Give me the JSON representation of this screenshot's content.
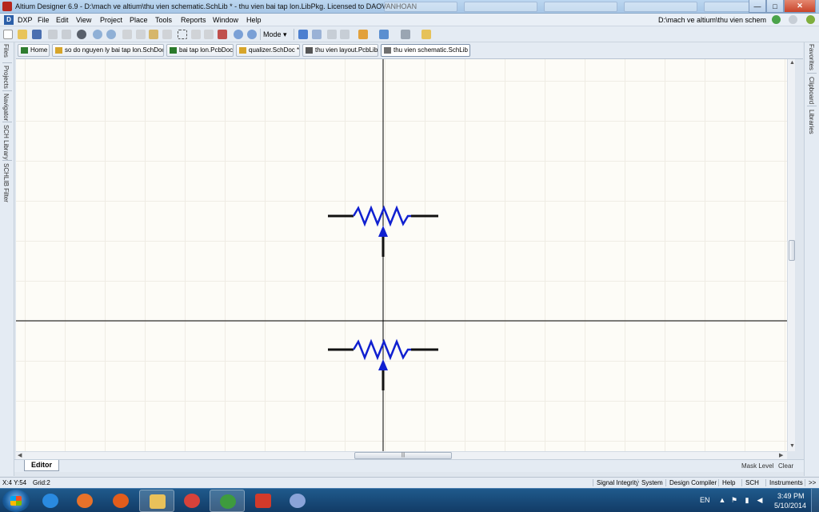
{
  "window": {
    "title": "Altium Designer 6.9 - D:\\mach ve altium\\thu vien schematic.SchLib * - thu vien bai tap lon.LibPkg. Licensed to DAOVANHOAN",
    "minimize": "—",
    "maximize": "□",
    "close": "✕"
  },
  "menu": {
    "items": [
      "DXP",
      "File",
      "Edit",
      "View",
      "Project",
      "Place",
      "Tools",
      "Reports",
      "Window",
      "Help"
    ],
    "path": "D:\\mach ve altium\\thu vien schem ▾"
  },
  "toolbar": {
    "mode_label": "Mode ▾"
  },
  "document_tabs": [
    {
      "label": "Home",
      "icon_color": "#2f7d2f"
    },
    {
      "label": "so do nguyen ly bai tap lon.SchDoc",
      "icon_color": "#d7a52a"
    },
    {
      "label": "bai tap lon.PcbDoc",
      "icon_color": "#2b7a2b"
    },
    {
      "label": "qualizer.SchDoc *",
      "icon_color": "#d7a52a"
    },
    {
      "label": "thu vien layout.PcbLib",
      "icon_color": "#555555"
    },
    {
      "label": "thu vien schematic.SchLib *",
      "icon_color": "#6f6f6f"
    }
  ],
  "left_panels": [
    "Files",
    "Projects",
    "Navigator",
    "SCH Library",
    "SCHLIB Filter"
  ],
  "right_panels": [
    "Favorites",
    "Clipboard",
    "Libraries"
  ],
  "schematic": {
    "components": [
      {
        "name": "potentiometer-1"
      },
      {
        "name": "potentiometer-2"
      }
    ],
    "wire_color": "#111111",
    "body_color": "#1020d0"
  },
  "editor": {
    "tab": "Editor",
    "mask_level": "Mask Level",
    "clear": "Clear"
  },
  "status": {
    "coords": "X:4 Y:54",
    "grid": "Grid:2",
    "panels": [
      "Signal Integrity",
      "System",
      "Design Compiler",
      "Help",
      "SCH",
      "Instruments",
      ">>"
    ]
  },
  "taskbar": {
    "apps": [
      {
        "name": "ie-icon",
        "color": "#2a8ae0"
      },
      {
        "name": "media-player-icon",
        "color": "#e8722a"
      },
      {
        "name": "firefox-icon",
        "color": "#e25d1c"
      },
      {
        "name": "explorer-icon",
        "color": "#e9c15a"
      },
      {
        "name": "chrome-icon",
        "color": "#d8423a"
      },
      {
        "name": "altium-icon",
        "color": "#3e9b3e"
      },
      {
        "name": "app-red-icon",
        "color": "#d23a2a"
      },
      {
        "name": "paint-icon",
        "color": "#8aa3d8"
      }
    ],
    "language": "EN",
    "time": "3:49 PM",
    "date": "5/10/2014"
  }
}
